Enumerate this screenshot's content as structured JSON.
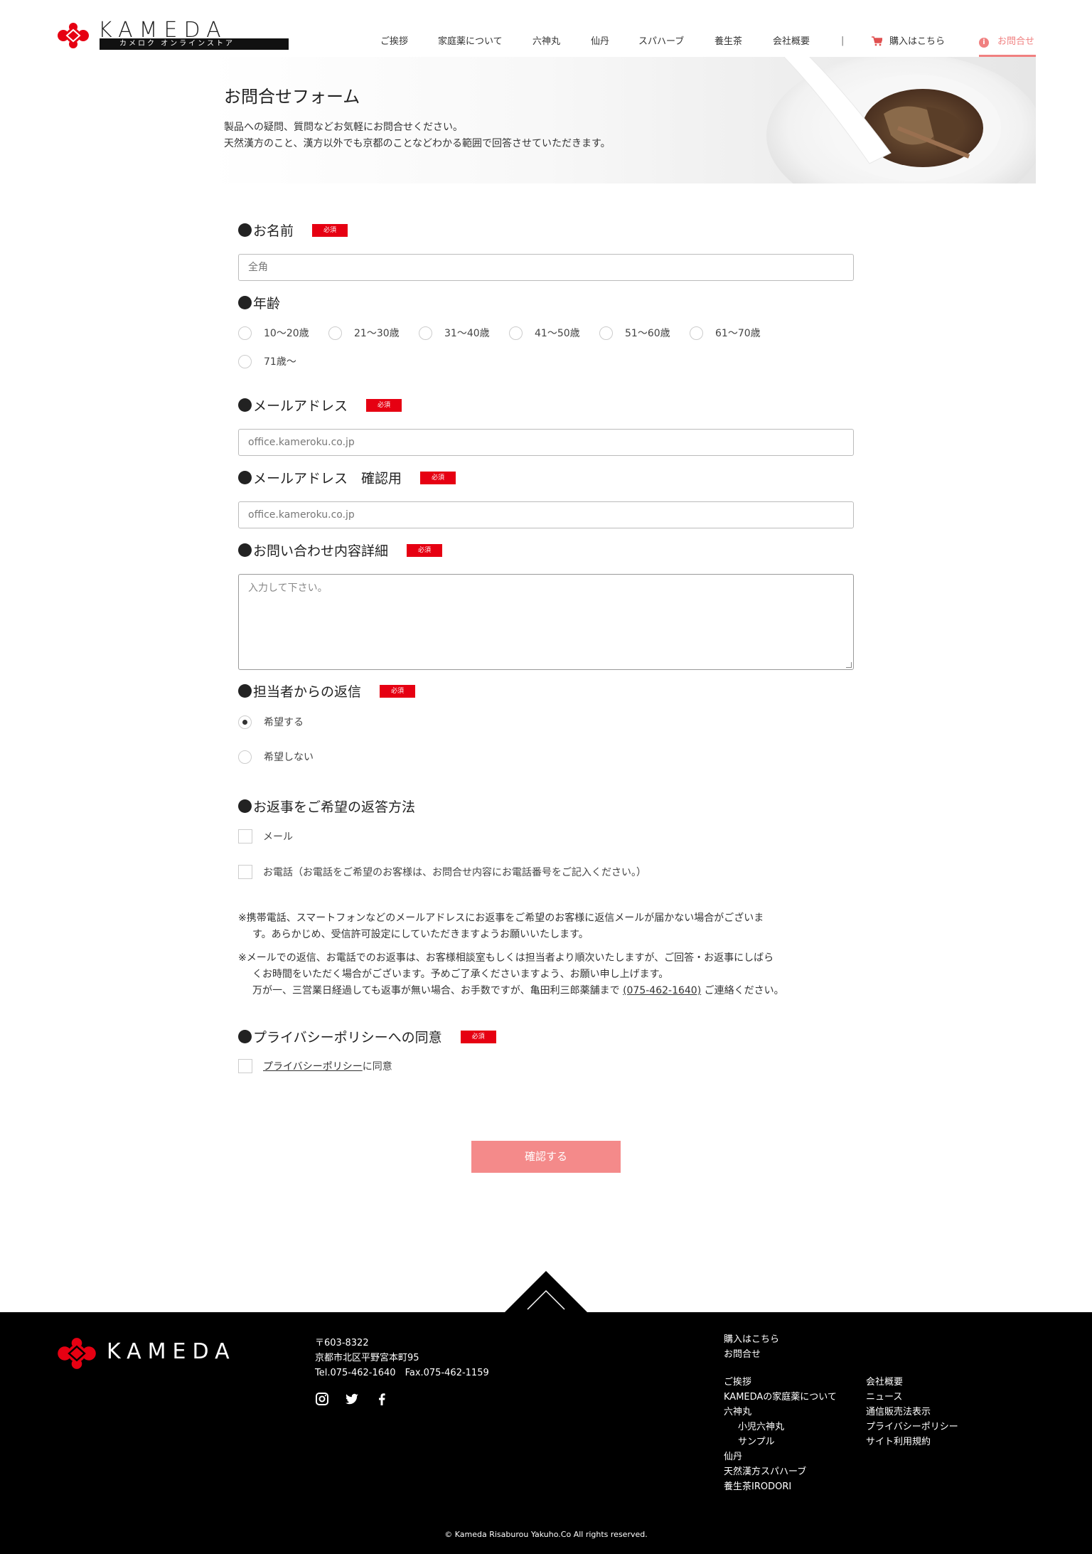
{
  "header": {
    "logo_text": "KAMEDA",
    "logo_sub": "カメロク オンラインストア",
    "nav": [
      "ご挨拶",
      "家庭薬について",
      "六神丸",
      "仙丹",
      "スパハーブ",
      "養生茶",
      "会社概要"
    ],
    "separator": "|",
    "cart_label": "購入はこちら",
    "contact_label": "お問合せ"
  },
  "hero": {
    "title": "お問合せフォーム",
    "desc_line1": "製品への疑問、質問などお気軽にお問合せください。",
    "desc_line2": "天然漢方のこと、漢方以外でも京都のことなどわかる範囲で回答させていただきます。"
  },
  "form": {
    "required_badge": "必須",
    "name": {
      "label": "お名前",
      "placeholder": "全角"
    },
    "age": {
      "label": "年齢",
      "options": [
        "10〜20歳",
        "21〜30歳",
        "31〜40歳",
        "41〜50歳",
        "51〜60歳",
        "61〜70歳",
        "71歳〜"
      ]
    },
    "email": {
      "label": "メールアドレス",
      "placeholder": "office.kameroku.co.jp"
    },
    "email_confirm": {
      "label": "メールアドレス　確認用",
      "placeholder": "office.kameroku.co.jp"
    },
    "details": {
      "label": "お問い合わせ内容詳細",
      "placeholder": "入力して下さい。"
    },
    "reply": {
      "label": "担当者からの返信",
      "options": [
        "希望する",
        "希望しない"
      ],
      "selected": "希望する"
    },
    "method": {
      "label": "お返事をご希望の返答方法",
      "options": [
        "メール",
        "お電話（お電話をご希望のお客様は、お問合せ内容にお電話番号をご記入ください。）"
      ]
    },
    "notes": {
      "n1_line1": "※携帯電話、スマートフォンなどのメールアドレスにお返事をご希望のお客様に返信メールが届かない場合がございま",
      "n1_line2": "す。あらかじめ、受信許可設定にしていただきますようお願いいたします。",
      "n2_line1": "※メールでの返信、お電話でのお返事は、お客様相談室もしくは担当者より順次いたしますが、ご回答・お返事にしばら",
      "n2_line2": "くお時間をいただく場合がございます。予めご了承くださいますよう、お願い申し上げます。",
      "n2_line3_pre": "万が一、三営業日経過しても返事が無い場合、お手数ですが、亀田利三郎薬舗まで",
      "n2_phone": "(075-462-1640)",
      "n2_line3_post": "ご連絡ください。"
    },
    "privacy": {
      "label": "プライバシーポリシーへの同意",
      "link": "プライバシーポリシー",
      "suffix": "に同意"
    },
    "submit": "確認する"
  },
  "footer": {
    "logo_text": "KAMEDA",
    "postal": "〒603-8322",
    "address": "京都市北区平野宮本町95",
    "tel_fax": "Tel.075-462-1640　Fax.075-462-1159",
    "links_top": [
      "購入はこちら",
      "お問合せ"
    ],
    "col1": [
      "ご挨拶",
      "KAMEDAの家庭薬について",
      "六神丸",
      "小児六神丸",
      "サンプル",
      "仙丹",
      "天然漢方スパハーブ",
      "養生茶IRODORI"
    ],
    "col2": [
      "会社概要",
      "ニュース",
      "通信販売法表示",
      "プライバシーポリシー",
      "サイト利用規約"
    ],
    "copyright": "© Kameda Risaburou Yakuho.Co All rights reserved."
  },
  "colors": {
    "accent": "#f08080",
    "required": "#e60012",
    "submit": "#f48a8a",
    "footer_bg": "#000000"
  },
  "icons": [
    "kameda-logo-icon",
    "cart-icon",
    "info-icon",
    "instagram-icon",
    "twitter-icon",
    "facebook-icon",
    "chevron-up-icon"
  ]
}
